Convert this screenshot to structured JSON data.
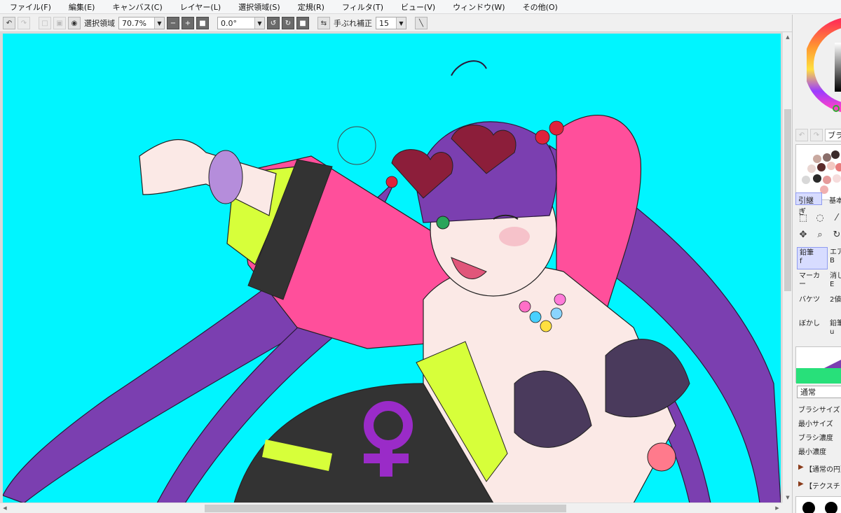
{
  "menu": [
    "ファイル(F)",
    "編集(E)",
    "キャンバス(C)",
    "レイヤー(L)",
    "選択領域(S)",
    "定規(R)",
    "フィルタ(T)",
    "ビュー(V)",
    "ウィンドウ(W)",
    "その他(O)"
  ],
  "toolbar": {
    "selection_label": "選択領域",
    "zoom_value": "70.7%",
    "rotation_value": "0.0°",
    "stabilizer_label": "手ぶれ補正",
    "stabilizer_value": "15"
  },
  "panel": {
    "tab_brush": "ブラ",
    "tab_inherit": "引継ぎ",
    "tab_basic": "基本",
    "tools": [
      {
        "label": "鉛筆",
        "key": "f",
        "selected": true
      },
      {
        "label": "エア",
        "key": "B",
        "selected": false
      },
      {
        "label": "マーカー",
        "key": "",
        "selected": false
      },
      {
        "label": "消し",
        "key": "E",
        "selected": false
      },
      {
        "label": "バケツ",
        "key": "",
        "selected": false
      },
      {
        "label": "2値",
        "key": "",
        "selected": false
      },
      {
        "label": "ぼかし",
        "key": "",
        "selected": false
      },
      {
        "label": "鉛筆",
        "key": "u",
        "selected": false
      }
    ],
    "blend_mode": "通常",
    "props": [
      "ブラシサイズ",
      "最小サイズ",
      "ブラシ濃度",
      "最小濃度"
    ],
    "section_circle": "【通常の円】",
    "section_texture": "【テクスチャ】"
  },
  "colors": {
    "canvas_bg": "#00f5ff",
    "hair": "#7b3fb0",
    "jacket_pink": "#ff4f9b",
    "jacket_lime": "#d7ff3a",
    "skin": "#fbe9e6",
    "dark": "#333333",
    "symbol": "#9a2bc8",
    "selected_tool_bg": "#d7dcff"
  }
}
